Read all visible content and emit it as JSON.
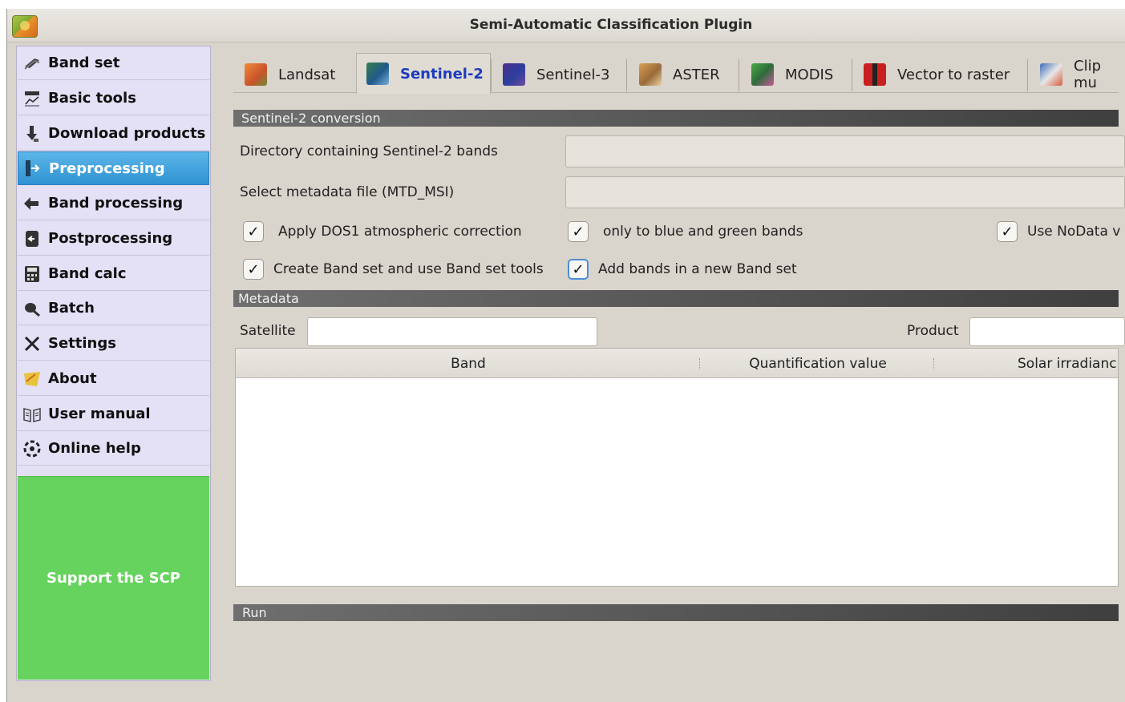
{
  "window": {
    "title": "Semi-Automatic Classification Plugin"
  },
  "sidebar": {
    "items": [
      {
        "label": "Band set",
        "icon": "band-set-icon"
      },
      {
        "label": "Basic tools",
        "icon": "basic-tools-icon"
      },
      {
        "label": "Download products",
        "icon": "download-icon"
      },
      {
        "label": "Preprocessing",
        "icon": "preprocessing-icon",
        "active": true
      },
      {
        "label": "Band processing",
        "icon": "band-processing-icon"
      },
      {
        "label": "Postprocessing",
        "icon": "postprocessing-icon"
      },
      {
        "label": "Band calc",
        "icon": "calculator-icon"
      },
      {
        "label": "Batch",
        "icon": "batch-icon"
      },
      {
        "label": "Settings",
        "icon": "settings-icon"
      },
      {
        "label": "About",
        "icon": "about-icon"
      },
      {
        "label": "User manual",
        "icon": "manual-icon"
      },
      {
        "label": "Online help",
        "icon": "help-icon"
      }
    ],
    "support_label": "Support the SCP",
    "support_color": "#66d35e",
    "active_color": "#3a9fdc"
  },
  "tabs": [
    {
      "label": "Landsat",
      "icon": "landsat-icon"
    },
    {
      "label": "Sentinel-2",
      "icon": "sentinel-2-icon",
      "active": true
    },
    {
      "label": "Sentinel-3",
      "icon": "sentinel-3-icon"
    },
    {
      "label": "ASTER",
      "icon": "aster-icon"
    },
    {
      "label": "MODIS",
      "icon": "modis-icon"
    },
    {
      "label": "Vector to raster",
      "icon": "vector-to-raster-icon"
    },
    {
      "label": "Clip mu",
      "icon": "clip-icon"
    }
  ],
  "conversion": {
    "section_title": "Sentinel-2 conversion",
    "dir_label": "Directory containing Sentinel-2 bands",
    "dir_value": "",
    "metadata_label": "Select metadata file (MTD_MSI)",
    "metadata_value": "",
    "checks": {
      "dos1": {
        "label": "Apply DOS1 atmospheric correction",
        "checked": true
      },
      "blue_green": {
        "label": "only to blue and green bands",
        "checked": true
      },
      "nodata": {
        "label": "Use NoData v",
        "checked": true
      },
      "create_bandset": {
        "label": "Create Band set and use Band set tools",
        "checked": true
      },
      "new_bandset": {
        "label": "Add bands in a new Band set",
        "checked": true
      }
    }
  },
  "metadata": {
    "section_title": "Metadata",
    "satellite_label": "Satellite",
    "satellite_value": "",
    "product_label": "Product",
    "product_value": "",
    "columns": [
      "Band",
      "Quantification value",
      "Solar irradianc"
    ]
  },
  "run": {
    "section_title": "Run"
  },
  "check_mark": "✓"
}
